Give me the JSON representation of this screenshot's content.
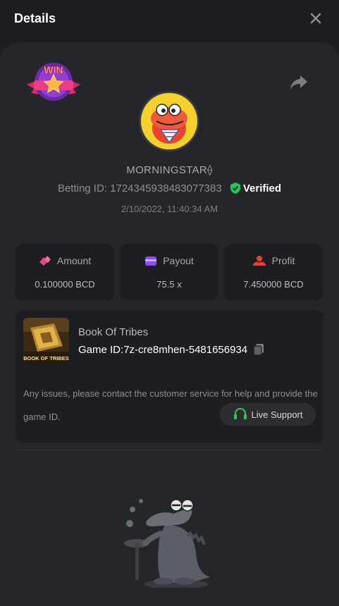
{
  "header": {
    "title": "Details",
    "close_icon": "close-icon"
  },
  "share_icon": "share-icon",
  "badge_text": "WIN",
  "player": {
    "username": "MORNINGSTAR⟠",
    "betting_id_label": "Betting ID:",
    "betting_id": "1724345938483077383",
    "verified_label": "Verified",
    "datetime": "2/10/2022, 11:40:34 AM"
  },
  "stats": [
    {
      "label": "Amount",
      "value": "0.100000 BCD",
      "icon": "coins-icon",
      "color": "#e84b7a"
    },
    {
      "label": "Payout",
      "value": "75.5 x",
      "icon": "wallet-icon",
      "color": "#8f4ef5"
    },
    {
      "label": "Profit",
      "value": "7.450000 BCD",
      "icon": "profit-icon",
      "color": "#e0413e"
    }
  ],
  "game": {
    "name": "Book Of Tribes",
    "id_label": "Game ID:",
    "id": "7z-cre8mhen-5481656934",
    "thumb_text": "BOOK OF TRIBES"
  },
  "support": {
    "note": "Any issues, please contact the customer service for help and provide the game ID.",
    "button_label": "Live Support",
    "icon": "headset-icon"
  },
  "colors": {
    "background": "#1c1d20",
    "card": "#25262a",
    "panel": "#1d1e21",
    "verified": "#23c55e",
    "accent_green": "#3dc45a"
  }
}
